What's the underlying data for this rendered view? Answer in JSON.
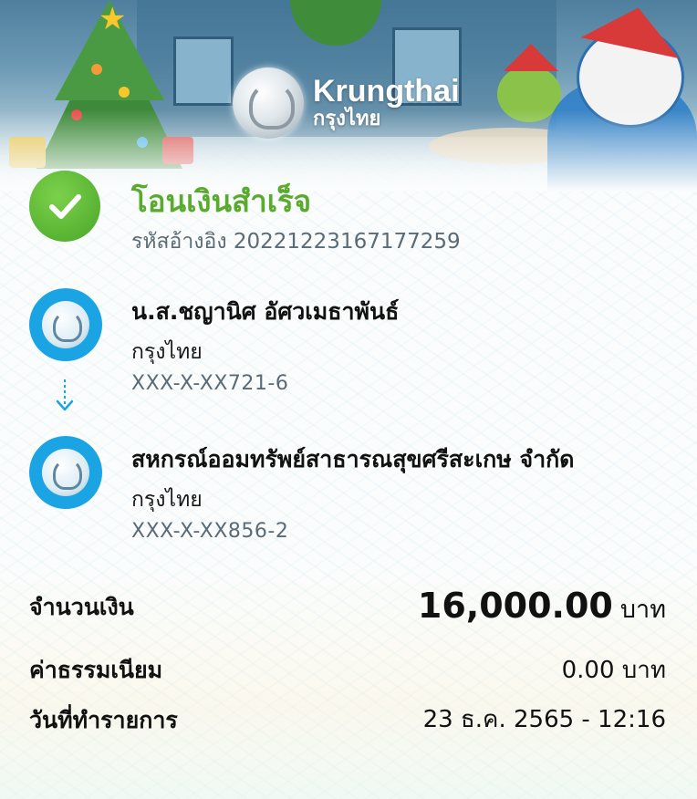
{
  "brand": {
    "name_en": "Krungthai",
    "name_th": "กรุงไทย"
  },
  "status": {
    "title": "โอนเงินสำเร็จ",
    "reference_label": "รหัสอ้างอิง",
    "reference_number": "20221223167177259",
    "color": "#5aaa2e"
  },
  "sender": {
    "name": "น.ส.ชญานิศ อัศวเมธาพันธ์",
    "bank": "กรุงไทย",
    "account": "XXX-X-XX721-6"
  },
  "receiver": {
    "name": "สหกรณ์ออมทรัพย์สาธารณสุขศรีสะเกษ จำกัด",
    "bank": "กรุงไทย",
    "account": "XXX-X-XX856-2"
  },
  "details": {
    "amount_label": "จำนวนเงิน",
    "amount_value": "16,000.00",
    "amount_unit": "บาท",
    "fee_label": "ค่าธรรมเนียม",
    "fee_value": "0.00 บาท",
    "date_label": "วันที่ทำรายการ",
    "date_value": "23 ธ.ค. 2565 - 12:16"
  },
  "icons": {
    "status": "check-circle-icon",
    "bank": "krungthai-bank-icon",
    "transfer_direction": "arrow-down-icon"
  },
  "colors": {
    "bank_blue": "#1ba4e3",
    "success_green": "#5aaa2e"
  }
}
